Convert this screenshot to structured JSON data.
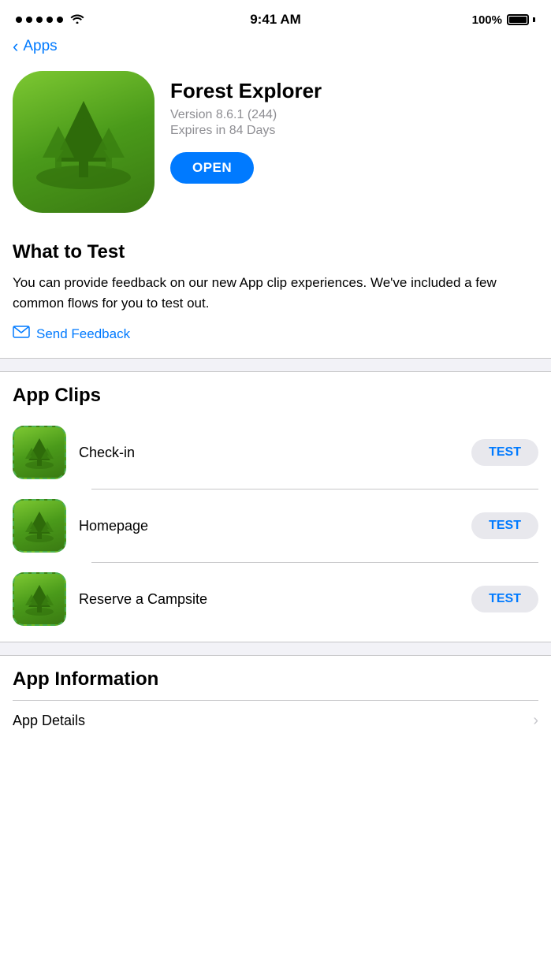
{
  "statusBar": {
    "time": "9:41 AM",
    "battery": "100%",
    "signalDots": 5
  },
  "nav": {
    "backLabel": "Apps",
    "backChevron": "<"
  },
  "app": {
    "name": "Forest Explorer",
    "version": "Version 8.6.1 (244)",
    "expires": "Expires in 84 Days",
    "openButton": "OPEN"
  },
  "whatToTest": {
    "title": "What to Test",
    "description": "You can provide feedback on our new App clip experiences. We've included a few common flows for you to test out.",
    "feedbackLabel": "Send Feedback"
  },
  "appClips": {
    "title": "App Clips",
    "items": [
      {
        "name": "Check-in",
        "buttonLabel": "TEST"
      },
      {
        "name": "Homepage",
        "buttonLabel": "TEST"
      },
      {
        "name": "Reserve a Campsite",
        "buttonLabel": "TEST"
      }
    ]
  },
  "appInformation": {
    "title": "App Information",
    "rows": [
      {
        "label": "App Details"
      }
    ]
  }
}
